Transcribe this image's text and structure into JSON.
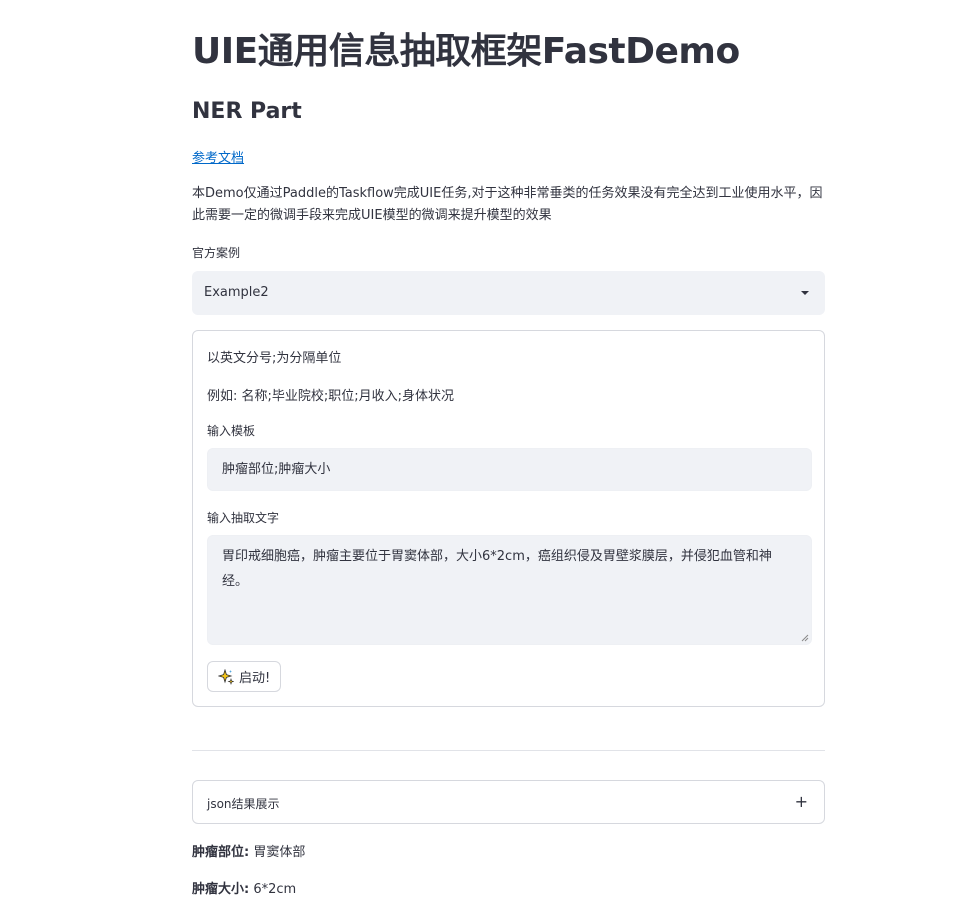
{
  "page": {
    "title": "UIE通用信息抽取框架FastDemo",
    "subtitle": "NER Part",
    "doc_link": "参考文档",
    "description": "本Demo仅通过Paddle的Taskflow完成UIE任务,对于这种非常垂类的任务效果没有完全达到工业使用水平，因此需要一定的微调手段来完成UIE模型的微调来提升模型的效果"
  },
  "case_select": {
    "label": "官方案例",
    "value": "Example2"
  },
  "form": {
    "hint1": "以英文分号;为分隔单位",
    "hint2": "例如: 名称;毕业院校;职位;月收入;身体状况",
    "template_label": "输入模板",
    "template_value": "肿瘤部位;肿瘤大小",
    "text_label": "输入抽取文字",
    "text_value": "胃印戒细胞癌，肿瘤主要位于胃窦体部，大小6*2cm，癌组织侵及胃壁浆膜层，并侵犯血管和神经。",
    "start_button": "启动!",
    "start_icon": "sparkle-icon"
  },
  "expander": {
    "label": "json结果展示",
    "icon": "plus-icon",
    "symbol": "+"
  },
  "results": [
    {
      "key": "肿瘤部位:",
      "value": "胃窦体部"
    },
    {
      "key": "肿瘤大小:",
      "value": "6*2cm"
    }
  ],
  "colors": {
    "link": "#0068c9",
    "text": "#31333f",
    "input_bg": "#f0f2f6",
    "border": "#d6d8de"
  }
}
